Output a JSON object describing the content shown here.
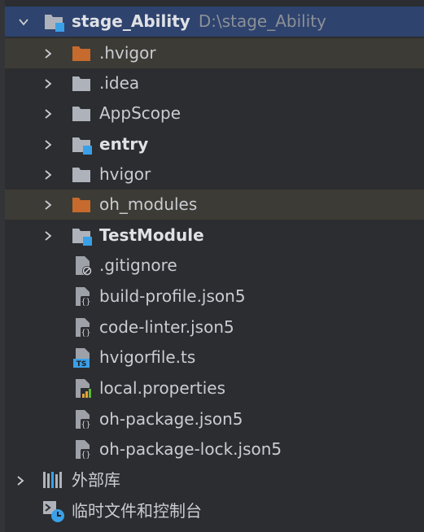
{
  "project": {
    "name": "stage_Ability",
    "path": "D:\\stage_Ability"
  },
  "items": [
    {
      "label": ".hvigor",
      "type": "folder-excluded"
    },
    {
      "label": ".idea",
      "type": "folder"
    },
    {
      "label": "AppScope",
      "type": "folder"
    },
    {
      "label": "entry",
      "type": "module"
    },
    {
      "label": "hvigor",
      "type": "folder"
    },
    {
      "label": "oh_modules",
      "type": "folder-excluded"
    },
    {
      "label": "TestModule",
      "type": "module"
    },
    {
      "label": ".gitignore",
      "type": "file-ignore"
    },
    {
      "label": "build-profile.json5",
      "type": "file-json"
    },
    {
      "label": "code-linter.json5",
      "type": "file-json"
    },
    {
      "label": "hvigorfile.ts",
      "type": "file-ts"
    },
    {
      "label": "local.properties",
      "type": "file-properties"
    },
    {
      "label": "oh-package.json5",
      "type": "file-json"
    },
    {
      "label": "oh-package-lock.json5",
      "type": "file-json"
    }
  ],
  "external_libraries": {
    "label": "外部库"
  },
  "scratches": {
    "label": "临时文件和控制台"
  },
  "icons": {
    "ts_badge": "TS"
  },
  "colors": {
    "selection": "#2e436e",
    "excluded_row": "#3d3b35",
    "folder": "#aeb3bb",
    "excluded_folder": "#c66a2d",
    "module_badge": "#3aa0e8",
    "file_body": "#9ea2a8"
  }
}
